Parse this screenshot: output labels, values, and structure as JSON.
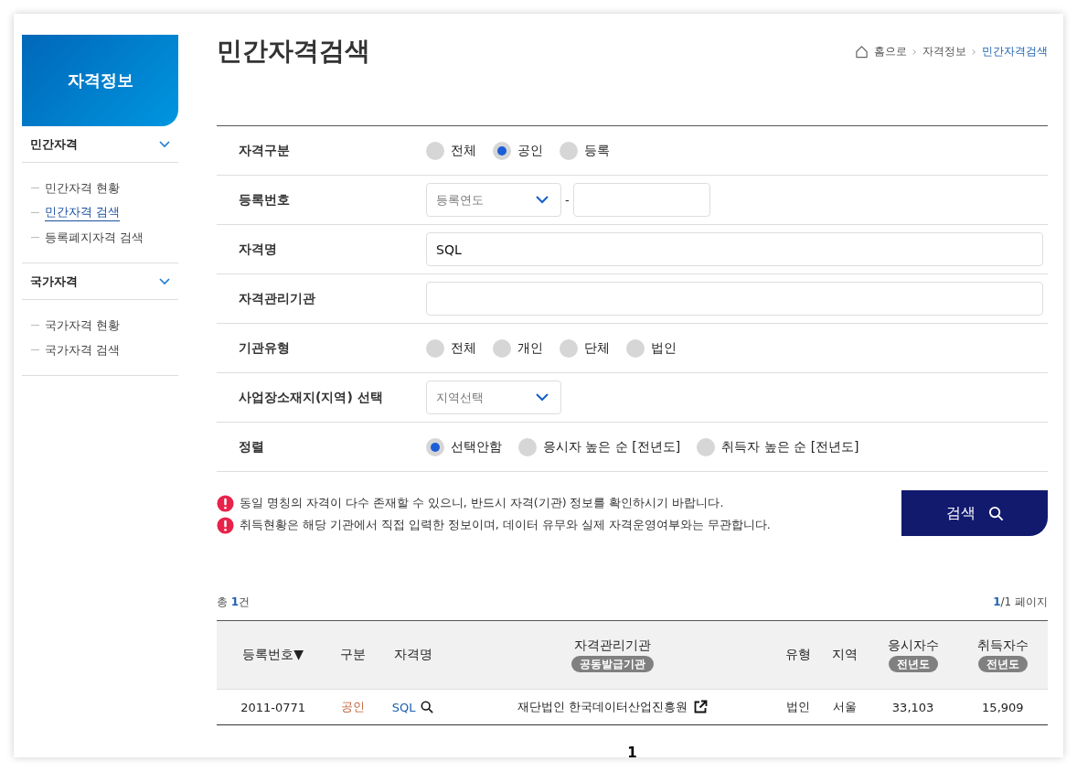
{
  "sidebar": {
    "title": "자격정보",
    "groups": [
      {
        "label": "민간자격",
        "expanded": true,
        "items": [
          {
            "label": "민간자격 현황",
            "selected": false
          },
          {
            "label": "민간자격 검색",
            "selected": true
          },
          {
            "label": "등록폐지자격 검색",
            "selected": false
          }
        ]
      },
      {
        "label": "국가자격",
        "expanded": true,
        "items": [
          {
            "label": "국가자격 현황",
            "selected": false
          },
          {
            "label": "국가자격 검색",
            "selected": false
          }
        ]
      }
    ]
  },
  "page_title": "민간자격검색",
  "breadcrumb": [
    {
      "label": "홈으로",
      "current": false
    },
    {
      "label": "자격정보",
      "current": false
    },
    {
      "label": "민간자격검색",
      "current": true
    }
  ],
  "form": {
    "rows": [
      {
        "kind": "radio",
        "label": "자격구분",
        "options": [
          {
            "label": "전체",
            "selected": false
          },
          {
            "label": "공인",
            "selected": true
          },
          {
            "label": "등록",
            "selected": false
          }
        ]
      },
      {
        "kind": "reg_number",
        "label": "등록번호",
        "placeholder": "등록연도",
        "separator": "-"
      },
      {
        "kind": "text",
        "label": "자격명",
        "value": "SQL"
      },
      {
        "kind": "text",
        "label": "자격관리기관"
      },
      {
        "kind": "radio",
        "label": "기관유형",
        "options": [
          {
            "label": "전체",
            "selected": false
          },
          {
            "label": "개인",
            "selected": false
          },
          {
            "label": "단체",
            "selected": false
          },
          {
            "label": "법인",
            "selected": false
          }
        ]
      },
      {
        "kind": "select",
        "label": "사업장소재지(지역) 선택",
        "placeholder": "지역선택"
      },
      {
        "kind": "radio",
        "label": "정렬",
        "options": [
          {
            "label": "선택안함",
            "selected": true
          },
          {
            "label": "응시자 높은 순 [전년도]",
            "selected": false
          },
          {
            "label": "취득자 높은 순 [전년도]",
            "selected": false
          }
        ]
      }
    ]
  },
  "notices": [
    "동일 명칭의 자격이 다수 존재할 수 있으니, 반드시 자격(기관) 정보를 확인하시기 바랍니다.",
    "취득현황은 해당 기관에서 직접 입력한 정보이며, 데이터 유무와 실제 자격운영여부와는 무관합니다."
  ],
  "search_button": "검색",
  "summary": {
    "prefix": "총",
    "count": "1",
    "suffix": "건",
    "page_current": "1",
    "page_rest": "/1 페이지"
  },
  "table": {
    "columns": [
      {
        "label": "등록번호",
        "sort": "▼"
      },
      {
        "label": "구분"
      },
      {
        "label": "자격명"
      },
      {
        "label": "자격관리기관",
        "badge": "공동발급기관"
      },
      {
        "label": "유형"
      },
      {
        "label": "지역"
      },
      {
        "label": "응시자수",
        "badge": "전년도"
      },
      {
        "label": "취득자수",
        "badge": "전년도"
      }
    ],
    "rows": [
      {
        "cells": [
          "2011-0771",
          "공인",
          "SQL",
          "재단법인 한국데이터산업진흥원",
          "법인",
          "서울",
          "33,103",
          "15,909"
        ]
      }
    ]
  },
  "pagination": [
    {
      "label": "1",
      "selected": true
    }
  ]
}
